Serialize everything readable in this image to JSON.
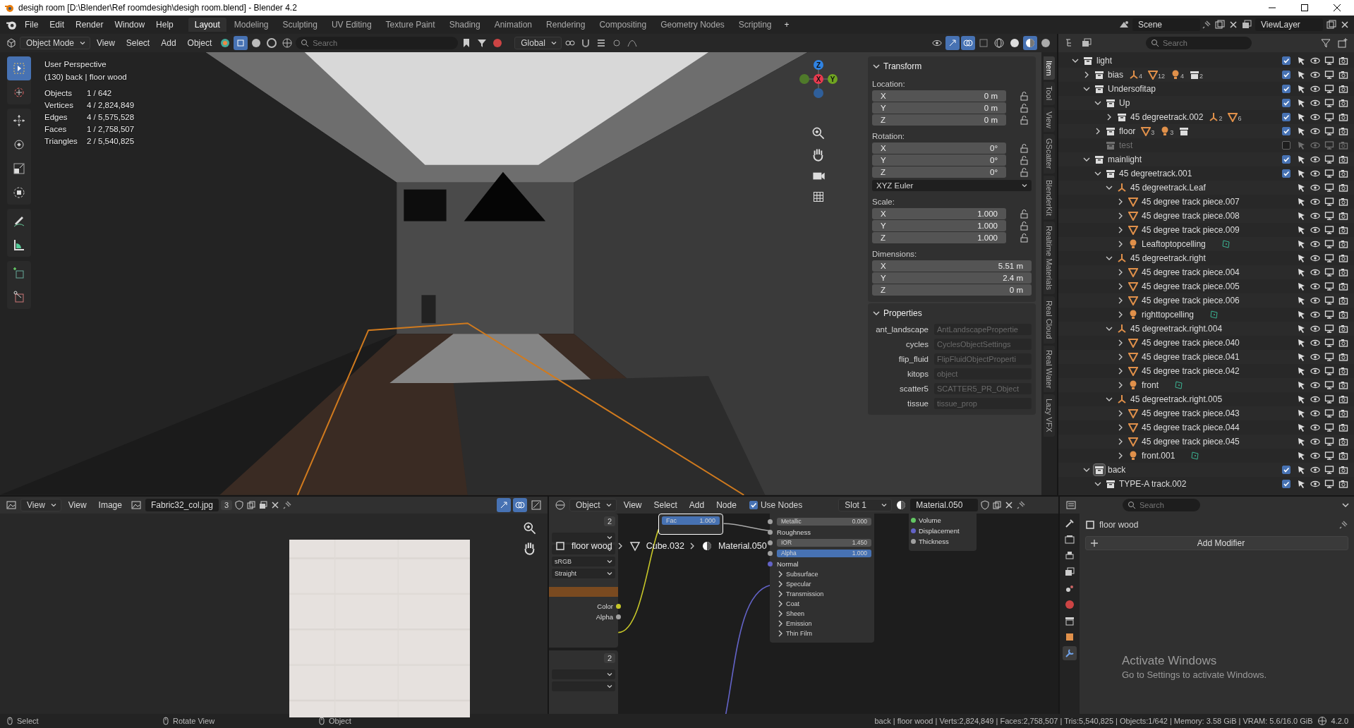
{
  "window": {
    "title": "desigh room [D:\\Blender\\Ref roomdesigh\\desigh room.blend] - Blender 4.2"
  },
  "menu": [
    "File",
    "Edit",
    "Render",
    "Window",
    "Help"
  ],
  "workspaces": [
    {
      "label": "Layout",
      "selected": true
    },
    {
      "label": "Modeling",
      "selected": false
    },
    {
      "label": "Sculpting",
      "selected": false
    },
    {
      "label": "UV Editing",
      "selected": false
    },
    {
      "label": "Texture Paint",
      "selected": false
    },
    {
      "label": "Shading",
      "selected": false
    },
    {
      "label": "Animation",
      "selected": false
    },
    {
      "label": "Rendering",
      "selected": false
    },
    {
      "label": "Compositing",
      "selected": false
    },
    {
      "label": "Geometry Nodes",
      "selected": false
    },
    {
      "label": "Scripting",
      "selected": false
    }
  ],
  "add_workspace": "+",
  "scene": "Scene",
  "view_layer": "ViewLayer",
  "viewport": {
    "mode": "Object Mode",
    "menus": [
      "View",
      "Select",
      "Add",
      "Object"
    ],
    "search_placeholder": "Search",
    "orientation": "Global",
    "tool_groups": [
      [
        {
          "kind": "select",
          "selected": true
        },
        {
          "kind": "cursor",
          "selected": false
        }
      ],
      [
        {
          "kind": "move",
          "selected": false
        },
        {
          "kind": "rotate",
          "selected": false
        },
        {
          "kind": "scale",
          "selected": false
        },
        {
          "kind": "transform",
          "selected": false
        }
      ],
      [
        {
          "kind": "annotate",
          "selected": false
        },
        {
          "kind": "measure",
          "selected": false
        }
      ],
      [
        {
          "kind": "add-cube",
          "selected": false
        },
        {
          "kind": "cut",
          "selected": false
        }
      ]
    ],
    "view_name": "User Perspective",
    "context": "(130) back | floor wood",
    "stats": [
      {
        "label": "Objects",
        "value": "1 / 642"
      },
      {
        "label": "Vertices",
        "value": "4 / 2,824,849"
      },
      {
        "label": "Edges",
        "value": "4 / 5,575,528"
      },
      {
        "label": "Faces",
        "value": "1 / 2,758,507"
      },
      {
        "label": "Triangles",
        "value": "2 / 5,540,825"
      }
    ],
    "gizmo_axes": [
      {
        "label": "Z",
        "color": "#2f83e3"
      },
      {
        "label": "X",
        "color": "#e83a4e"
      },
      {
        "label": "Y",
        "color": "#6fa421"
      }
    ],
    "sidebar_tabs": [
      {
        "label": "Item",
        "selected": true
      },
      {
        "label": "Tool",
        "selected": false
      },
      {
        "label": "View",
        "selected": false
      },
      {
        "label": "GScatter",
        "selected": false
      },
      {
        "label": "BlenderKit",
        "selected": false
      },
      {
        "label": "Realtime Materials",
        "selected": false
      },
      {
        "label": "Real Cloud",
        "selected": false
      },
      {
        "label": "Real Water",
        "selected": false
      },
      {
        "label": "Lazy VFX",
        "selected": false
      }
    ],
    "transform": {
      "title": "Transform",
      "groups": [
        {
          "label": "Location:",
          "lockable": true,
          "fields": [
            {
              "axis": "X",
              "value": "0 m"
            },
            {
              "axis": "Y",
              "value": "0 m"
            },
            {
              "axis": "Z",
              "value": "0 m"
            }
          ]
        },
        {
          "label": "Rotation:",
          "lockable": true,
          "fields": [
            {
              "axis": "X",
              "value": "0°"
            },
            {
              "axis": "Y",
              "value": "0°"
            },
            {
              "axis": "Z",
              "value": "0°"
            }
          ],
          "dropdown": "XYZ Euler"
        },
        {
          "label": "Scale:",
          "lockable": true,
          "fields": [
            {
              "axis": "X",
              "value": "1.000"
            },
            {
              "axis": "Y",
              "value": "1.000"
            },
            {
              "axis": "Z",
              "value": "1.000"
            }
          ]
        },
        {
          "label": "Dimensions:",
          "lockable": false,
          "fields": [
            {
              "axis": "X",
              "value": "5.51 m"
            },
            {
              "axis": "Y",
              "value": "2.4 m"
            },
            {
              "axis": "Z",
              "value": "0 m"
            }
          ]
        }
      ]
    },
    "properties": {
      "title": "Properties",
      "rows": [
        {
          "label": "ant_landscape",
          "value": "AntLandscapePropertie"
        },
        {
          "label": "cycles",
          "value": "CyclesObjectSettings"
        },
        {
          "label": "flip_fluid",
          "value": "FlipFluidObjectProperti"
        },
        {
          "label": "kitops",
          "value": "object"
        },
        {
          "label": "scatter5",
          "value": "SCATTER5_PR_Object"
        },
        {
          "label": "tissue",
          "value": "tissue_prop"
        }
      ]
    }
  },
  "outliner": {
    "search_placeholder": "Search",
    "tree": [
      {
        "name": "light",
        "kind": "collection",
        "expanded": true,
        "checked": true,
        "children": [
          {
            "name": "bias",
            "kind": "collection",
            "expanded": false,
            "checked": true,
            "badges": [
              {
                "kind": "empty",
                "count": "4"
              },
              {
                "kind": "mesh",
                "count": "12"
              },
              {
                "kind": "light",
                "count": "4"
              },
              {
                "kind": "collection",
                "count": "2"
              }
            ]
          },
          {
            "name": "Undersofitap",
            "kind": "collection",
            "expanded": true,
            "checked": true,
            "children": [
              {
                "name": "Up",
                "kind": "collection",
                "expanded": true,
                "checked": true,
                "children": [
                  {
                    "name": "45 degreetrack.002",
                    "kind": "collection",
                    "expanded": false,
                    "checked": true,
                    "badges": [
                      {
                        "kind": "empty",
                        "count": "2"
                      },
                      {
                        "kind": "mesh",
                        "count": "6"
                      }
                    ]
                  }
                ]
              },
              {
                "name": "floor",
                "kind": "collection",
                "expanded": false,
                "checked": true,
                "badges": [
                  {
                    "kind": "mesh",
                    "count": "3"
                  },
                  {
                    "kind": "light",
                    "count": "3"
                  },
                  {
                    "kind": "collection"
                  }
                ]
              },
              {
                "name": "test",
                "kind": "collection",
                "checked": false,
                "disabled": true
              }
            ]
          },
          {
            "name": "mainlight",
            "kind": "collection",
            "expanded": true,
            "checked": true,
            "children": [
              {
                "name": "45 degreetrack.001",
                "kind": "collection",
                "expanded": true,
                "checked": true,
                "children": [
                  {
                    "name": "45 degreetrack.Leaf",
                    "kind": "empty",
                    "expanded": true,
                    "children": [
                      {
                        "name": "45 degree track piece.007",
                        "kind": "mesh",
                        "expanded": false
                      },
                      {
                        "name": "45 degree track piece.008",
                        "kind": "mesh",
                        "expanded": false
                      },
                      {
                        "name": "45 degree track piece.009",
                        "kind": "mesh",
                        "expanded": false
                      },
                      {
                        "name": "Leaftoptopcelling",
                        "kind": "light",
                        "expanded": false,
                        "light_linking": true
                      }
                    ]
                  },
                  {
                    "name": "45 degreetrack.right",
                    "kind": "empty",
                    "expanded": true,
                    "children": [
                      {
                        "name": "45 degree track piece.004",
                        "kind": "mesh",
                        "expanded": false
                      },
                      {
                        "name": "45 degree track piece.005",
                        "kind": "mesh",
                        "expanded": false
                      },
                      {
                        "name": "45 degree track piece.006",
                        "kind": "mesh",
                        "expanded": false
                      },
                      {
                        "name": "righttopcelling",
                        "kind": "light",
                        "expanded": false,
                        "light_linking": true
                      }
                    ]
                  },
                  {
                    "name": "45 degreetrack.right.004",
                    "kind": "empty",
                    "expanded": true,
                    "children": [
                      {
                        "name": "45 degree track piece.040",
                        "kind": "mesh",
                        "expanded": false
                      },
                      {
                        "name": "45 degree track piece.041",
                        "kind": "mesh",
                        "expanded": false
                      },
                      {
                        "name": "45 degree track piece.042",
                        "kind": "mesh",
                        "expanded": false
                      },
                      {
                        "name": "front",
                        "kind": "light",
                        "expanded": false,
                        "light_linking": true
                      }
                    ]
                  },
                  {
                    "name": "45 degreetrack.right.005",
                    "kind": "empty",
                    "expanded": true,
                    "children": [
                      {
                        "name": "45 degree track piece.043",
                        "kind": "mesh",
                        "expanded": false
                      },
                      {
                        "name": "45 degree track piece.044",
                        "kind": "mesh",
                        "expanded": false
                      },
                      {
                        "name": "45 degree track piece.045",
                        "kind": "mesh",
                        "expanded": false
                      },
                      {
                        "name": "front.001",
                        "kind": "light",
                        "expanded": false,
                        "light_linking": true
                      }
                    ]
                  }
                ]
              }
            ]
          },
          {
            "name": "back",
            "kind": "collection",
            "expanded": true,
            "checked": true,
            "active": true,
            "children": [
              {
                "name": "TYPE-A track.002",
                "kind": "collection",
                "expanded": true,
                "checked": true
              }
            ]
          }
        ]
      }
    ]
  },
  "image_editor": {
    "view_mode": "View",
    "menus": [
      "View",
      "Image"
    ],
    "image": "Fabric32_col.jpg",
    "users": "3"
  },
  "node_editor": {
    "type": "Object",
    "menus": [
      "View",
      "Select",
      "Add",
      "Node"
    ],
    "use_nodes": true,
    "use_nodes_label": "Use Nodes",
    "slot": "Slot 1",
    "material": "Material.050",
    "breadcrumb": [
      "floor wood",
      "Cube.032",
      "Material.050"
    ],
    "image_nodes": [
      {
        "users": "2",
        "dropdowns": [
          "sRGB",
          "Straight"
        ],
        "outputs": [
          {
            "label": "Color",
            "color": "#c7c729"
          },
          {
            "label": "Alpha",
            "color": "#a1a1a1"
          }
        ]
      },
      {
        "users": "2"
      }
    ],
    "mix": {
      "label": "Fac",
      "value": "1.000",
      "level": 1
    },
    "principled": {
      "inputs": [
        {
          "label": "Metallic",
          "value": "0.000",
          "kind": "field",
          "color": "#a1a1a1"
        },
        {
          "label": "Roughness",
          "kind": "socket",
          "color": "#a1a1a1"
        },
        {
          "label": "IOR",
          "value": "1.450",
          "kind": "field",
          "color": "#a1a1a1"
        },
        {
          "label": "Alpha",
          "value": "1.000",
          "kind": "slider",
          "level": 1,
          "color": "#a1a1a1"
        },
        {
          "label": "Normal",
          "kind": "socket",
          "color": "#6363c7"
        }
      ],
      "panels": [
        "Subsurface",
        "Specular",
        "Transmission",
        "Coat",
        "Sheen",
        "Emission",
        "Thin Film"
      ]
    },
    "output": {
      "sockets": [
        {
          "label": "Volume",
          "color": "#63c763"
        },
        {
          "label": "Displacement",
          "color": "#6363c7"
        },
        {
          "label": "Thickness",
          "color": "#a1a1a1"
        }
      ]
    }
  },
  "properties_editor": {
    "search_placeholder": "Search",
    "object": "floor wood",
    "button": "Add Modifier",
    "tabs": [
      {
        "kind": "tool",
        "selected": false
      },
      {
        "kind": "render",
        "selected": false
      },
      {
        "kind": "output",
        "selected": false
      },
      {
        "kind": "view-layer",
        "selected": false
      },
      {
        "kind": "scene",
        "selected": false
      },
      {
        "kind": "world",
        "selected": false
      },
      {
        "kind": "collection",
        "selected": false
      },
      {
        "kind": "object",
        "selected": false
      },
      {
        "kind": "modifier",
        "selected": true
      }
    ]
  },
  "activation": {
    "title": "Activate Windows",
    "text": "Go to Settings to activate Windows."
  },
  "status_bar": {
    "hints": [
      "Select",
      "Rotate View",
      "Object"
    ],
    "info": "back | floor wood | Verts:2,824,849 | Faces:2,758,507 | Tris:5,540,825 | Objects:1/642 | Memory: 3.58 GiB | VRAM: 5.6/16.0 GiB",
    "version": "4.2.0"
  }
}
